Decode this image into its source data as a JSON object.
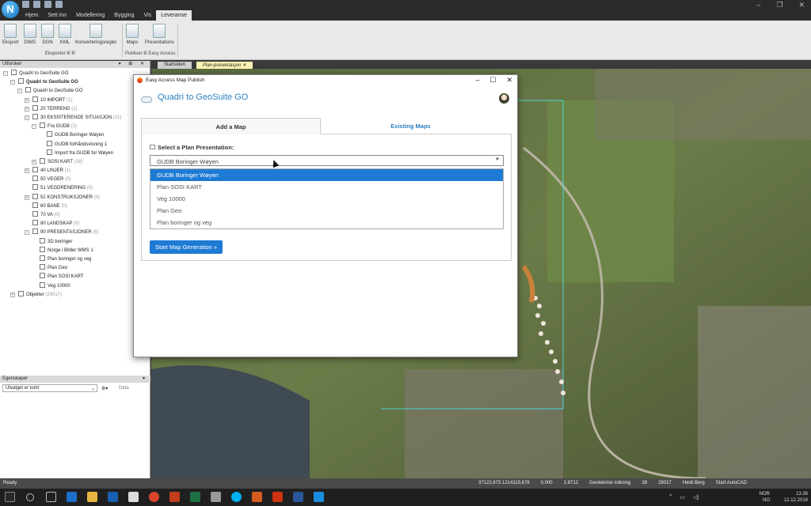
{
  "app": {
    "logo_letter": "N"
  },
  "window_controls": [
    "–",
    "❐",
    "✕"
  ],
  "menu": {
    "items": [
      "Hjem",
      "Sett inn",
      "Modellering",
      "Bygging",
      "Vis",
      "Leveranse"
    ],
    "active": "Leveranse"
  },
  "ribbon": {
    "buttons": [
      "Eksport",
      "DWG",
      "DGN",
      "KML",
      "Konverteringsregler",
      "Maps",
      "Presentations"
    ],
    "groups": [
      "Eksporter til fil",
      "Publiser til Easy Access"
    ]
  },
  "explorer": {
    "title": "Utforsker",
    "tree": [
      {
        "label": "Quadri to GeoSuite GO",
        "count": "",
        "level": 0,
        "bold": false,
        "exp": "−"
      },
      {
        "label": "Quadri to GeoSuite GO",
        "count": "",
        "level": 1,
        "bold": true,
        "exp": "−"
      },
      {
        "label": "Quadri to GeoSuite GO",
        "count": "",
        "level": 2,
        "bold": false,
        "exp": "−"
      },
      {
        "label": "10 IMPORT",
        "count": "(1)",
        "level": 3,
        "bold": false,
        "exp": "+"
      },
      {
        "label": "20 TERRENG",
        "count": "(1)",
        "level": 3,
        "bold": false,
        "exp": "+"
      },
      {
        "label": "30 EKSISTERENDE SITUASJON",
        "count": "(21)",
        "level": 3,
        "bold": false,
        "exp": "−"
      },
      {
        "label": "Fra GUDB",
        "count": "(3)",
        "level": 4,
        "bold": false,
        "exp": "−"
      },
      {
        "label": "GUDB Boringer Wøyen",
        "count": "",
        "level": 5,
        "bold": false,
        "exp": ""
      },
      {
        "label": "GUDB forhåndsvisning 1",
        "count": "",
        "level": 5,
        "bold": false,
        "exp": ""
      },
      {
        "label": "Import fra GUDB for Wøyen",
        "count": "",
        "level": 5,
        "bold": false,
        "exp": ""
      },
      {
        "label": "SOSI KART",
        "count": "(18)",
        "level": 4,
        "bold": false,
        "exp": "+"
      },
      {
        "label": "40 LINJER",
        "count": "(1)",
        "level": 3,
        "bold": false,
        "exp": "+"
      },
      {
        "label": "50 VEGER",
        "count": "(0)",
        "level": 3,
        "bold": false,
        "exp": ""
      },
      {
        "label": "51 VEGDRENERING",
        "count": "(0)",
        "level": 3,
        "bold": false,
        "exp": ""
      },
      {
        "label": "52 KONSTRUKSJONER",
        "count": "(0)",
        "level": 3,
        "bold": false,
        "exp": "+"
      },
      {
        "label": "60 BANE",
        "count": "(0)",
        "level": 3,
        "bold": false,
        "exp": ""
      },
      {
        "label": "70 VA",
        "count": "(0)",
        "level": 3,
        "bold": false,
        "exp": ""
      },
      {
        "label": "80 LANDSKAP",
        "count": "(0)",
        "level": 3,
        "bold": false,
        "exp": ""
      },
      {
        "label": "90 PRESENTASJONER",
        "count": "(6)",
        "level": 3,
        "bold": false,
        "exp": "−"
      },
      {
        "label": "3D boringer",
        "count": "",
        "level": 4,
        "bold": false,
        "exp": ""
      },
      {
        "label": "Norge i Bilder WMS 1",
        "count": "",
        "level": 4,
        "bold": false,
        "exp": ""
      },
      {
        "label": "Plan boringer og veg",
        "count": "",
        "level": 4,
        "bold": false,
        "exp": ""
      },
      {
        "label": "Plan Geo",
        "count": "",
        "level": 4,
        "bold": false,
        "exp": ""
      },
      {
        "label": "Plan SOSI KART",
        "count": "",
        "level": 4,
        "bold": false,
        "exp": ""
      },
      {
        "label": "Veg 10000",
        "count": "",
        "level": 4,
        "bold": false,
        "exp": ""
      },
      {
        "label": "Objekter",
        "count": "(29017)",
        "level": 1,
        "bold": false,
        "exp": "+"
      }
    ]
  },
  "properties": {
    "title": "Egenskaper",
    "selection": "Utvalget er tomt",
    "detail": "Deta"
  },
  "doc_tabs": [
    "Startsiden",
    "Plan-presentasjon"
  ],
  "dialog": {
    "title": "Easy Access Map Publish",
    "app_title": "Quadri to GeoSuite GO",
    "tabs": [
      "Add a Map",
      "Existing Maps"
    ],
    "select_label": "Select a Plan Presentation:",
    "selected": "GUDB Boringer Wøyen",
    "options": [
      "GUDB Boringer Wøyen",
      "Plan SOSI KART",
      "Veg 10000",
      "Plan Geo",
      "Plan boringer og veg"
    ],
    "start_button": "Start Map Generation »"
  },
  "statusbar": {
    "left": "Ready",
    "items": [
      "37122,673 1214119,678",
      "0,000",
      "1:8712",
      "Geoteknisk tolkning",
      "38",
      "29017",
      "Heidi Berg",
      "Start AutoCAD"
    ]
  },
  "taskbar": {
    "time": "13.38",
    "date": "12.12.2016",
    "lang": "NOR\nNO"
  },
  "colors": {
    "accent": "#1e7bd4",
    "title_blue": "#2a7fbf",
    "chrome_dark": "#2b2b2b"
  }
}
